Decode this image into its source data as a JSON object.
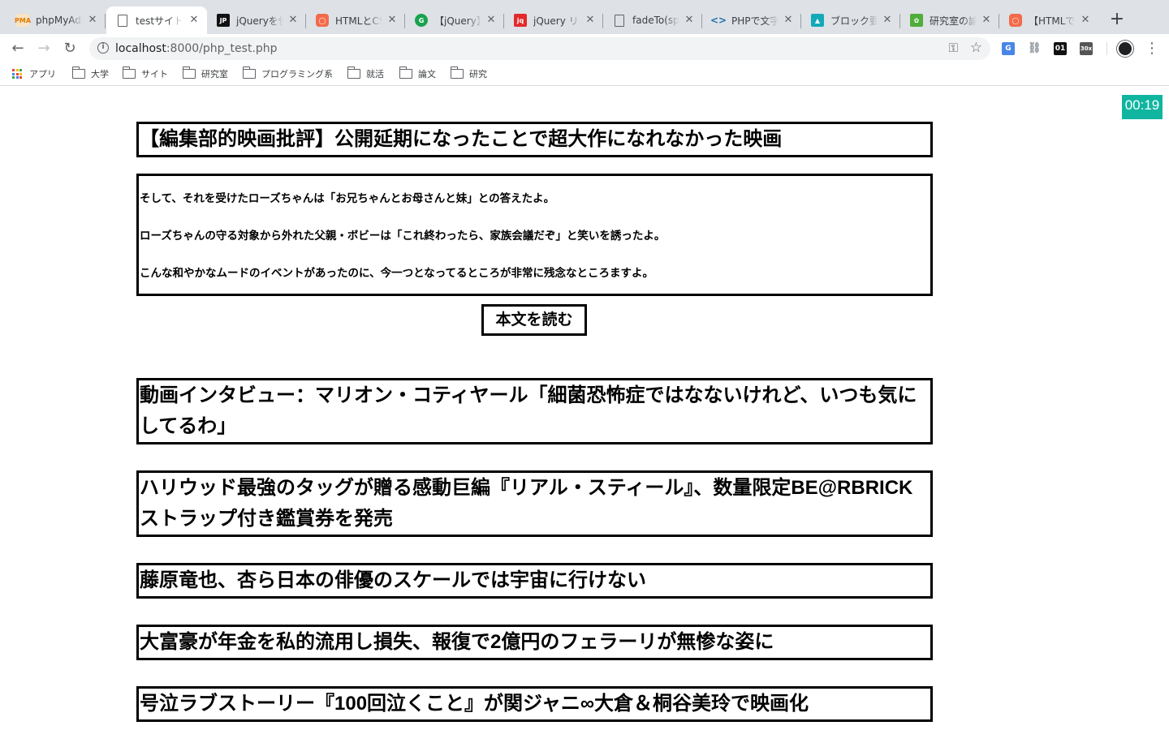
{
  "browser": {
    "tabs": [
      {
        "label": "phpMyAdmin",
        "favicon": "pma-icon",
        "color": "#f29111"
      },
      {
        "label": "testサイト",
        "favicon": "page-icon",
        "active": true
      },
      {
        "label": "jQueryを使",
        "favicon": "web-jp-icon",
        "color": "#111111"
      },
      {
        "label": "HTMLとCSS",
        "favicon": "circle-orange-icon",
        "color": "#f26b4b"
      },
      {
        "label": "【jQuery】",
        "favicon": "g-green-icon",
        "color": "#1aa24e"
      },
      {
        "label": "jQuery リフ",
        "favicon": "jq-red-icon",
        "color": "#e32a2a"
      },
      {
        "label": "fadeTo(spe",
        "favicon": "page-icon"
      },
      {
        "label": "PHPで文字",
        "favicon": "code-icon",
        "color": "#1a73a8"
      },
      {
        "label": "ブロック要",
        "favicon": "teal-icon",
        "color": "#13a9b8"
      },
      {
        "label": "研究室の論",
        "favicon": "leaf-icon",
        "color": "#4fad3a"
      },
      {
        "label": "【HTMLで",
        "favicon": "circle-orange-icon",
        "color": "#f26b4b"
      }
    ],
    "url_host": "localhost",
    "url_path": ":8000/php_test.php",
    "bookmarks": [
      "アプリ",
      "大学",
      "サイト",
      "研究室",
      "プログラミング系",
      "就活",
      "論文",
      "研究"
    ]
  },
  "page": {
    "timer": "00:19",
    "featured": {
      "title": "【編集部的映画批評】公開延期になったことで超大作になれなかった映画",
      "paragraphs": [
        "そして、それを受けたローズちゃんは「お兄ちゃんとお母さんと妹」との答えたよ。",
        "ローズちゃんの守る対象から外れた父親・ボビーは「これ終わったら、家族会議だぞ」と笑いを誘ったよ。",
        "こんな和やかなムードのイベントがあったのに、今一つとなってるところが非常に残念なところますよ。"
      ],
      "read_button": "本文を読む"
    },
    "articles": [
      "動画インタビュー：マリオン・コティヤール「細菌恐怖症ではなないけれど、いつも気にしてるわ」",
      "ハリウッド最強のタッグが贈る感動巨編『リアル・スティール』、数量限定BE@RBRICKストラップ付き鑑賞券を発売",
      "藤原竜也、杏ら日本の俳優のスケールでは宇宙に行けない",
      "大富豪が年金を私的流用し損失、報復で2億円のフェラーリが無惨な姿に",
      "号泣ラブストーリー『100回泣くこと』が関ジャニ∞大倉＆桐谷美玲で映画化"
    ]
  }
}
